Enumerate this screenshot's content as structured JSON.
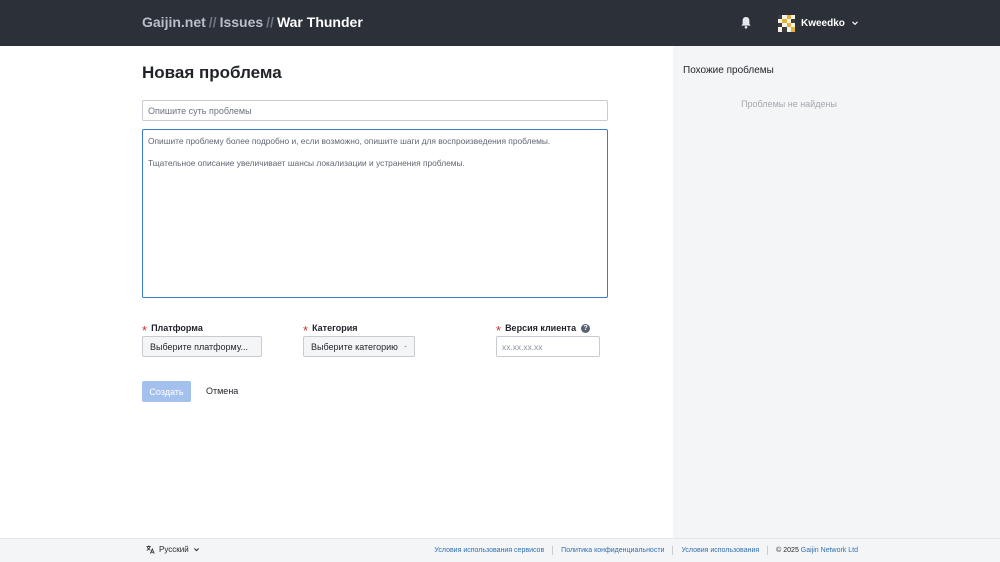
{
  "header": {
    "crumbs": [
      "Gaijin.net",
      "Issues",
      "War Thunder"
    ],
    "separator": "//",
    "username": "Kweedko"
  },
  "form": {
    "title": "Новая проблема",
    "summary_placeholder": "Опишите суть проблемы",
    "description_placeholder": "Опишите проблему более подробно и, если возможно, опишите шаги для воспроизведения проблемы.\n\nТщательное описание увеличивает шансы локализации и устранения проблемы.",
    "platform": {
      "label": "Платформа",
      "value": "Выберите платформу..."
    },
    "category": {
      "label": "Категория",
      "value": "Выберите категорию"
    },
    "version": {
      "label": "Версия клиента",
      "placeholder": "xx.xx.xx.xx"
    },
    "create_label": "Создать",
    "cancel_label": "Отмена"
  },
  "sidebar": {
    "title": "Похожие проблемы",
    "empty": "Проблемы не найдены"
  },
  "footer": {
    "language": "Русский",
    "links": [
      "Условия использования сервисов",
      "Политика конфиденциальности",
      "Условия использования"
    ],
    "copyright_prefix": "© 2025",
    "company": "Gaijin Network Ltd"
  },
  "colors": {
    "header_bg": "#2c3039",
    "accent": "#3b7bd0",
    "required": "#d0312d",
    "create_disabled": "#a4c0ec",
    "link": "#2f6fb3"
  },
  "icons": {
    "notifications": "bell-icon",
    "user_menu": "chevron-down-icon",
    "required": "asterisk-icon",
    "help": "question-circle-icon",
    "language": "translate-icon"
  }
}
